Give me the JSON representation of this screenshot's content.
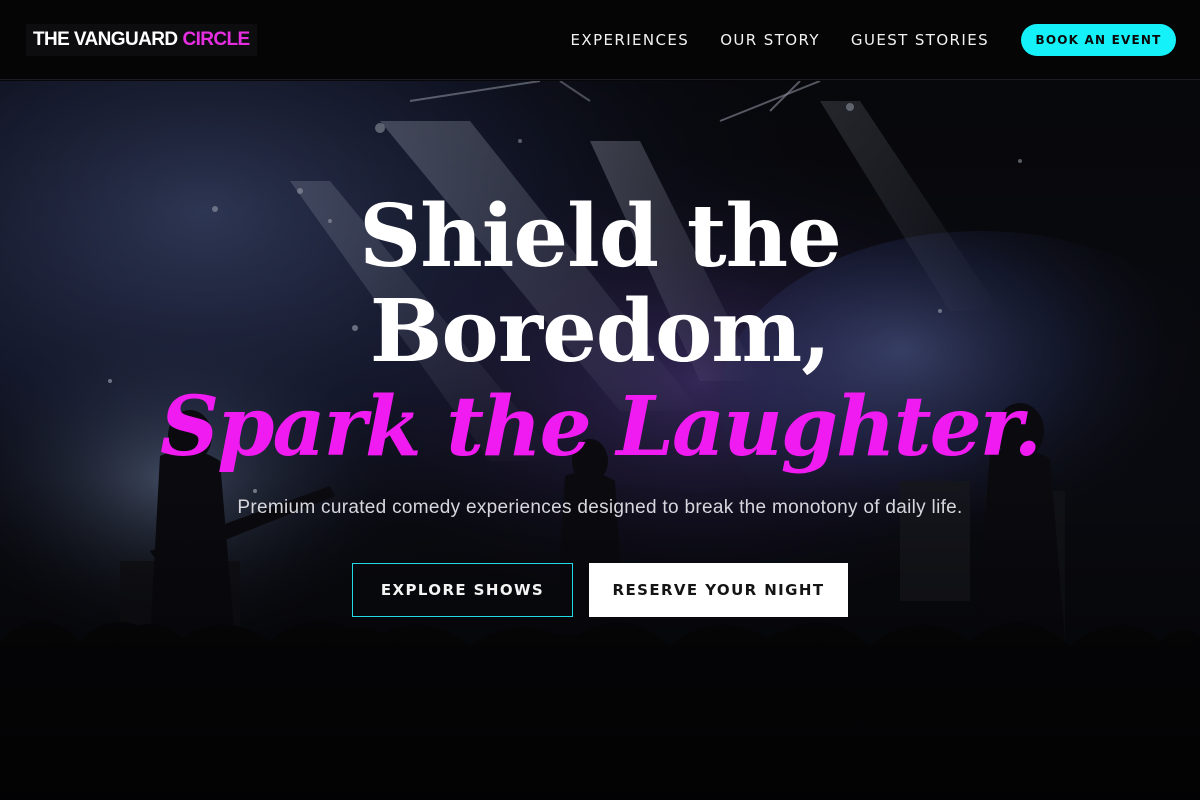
{
  "brand": {
    "primary": "THE VANGUARD",
    "accent": "CIRCLE"
  },
  "nav": {
    "links": [
      "EXPERIENCES",
      "OUR STORY",
      "GUEST STORIES"
    ],
    "cta_label": "BOOK AN EVENT"
  },
  "hero": {
    "title_line1": "Shield the",
    "title_line2": "Boredom,",
    "title_line3": "Spark the Laughter.",
    "subtitle": "Premium curated comedy experiences designed to break the monotony of daily life.",
    "primary_button": "EXPLORE SHOWS",
    "secondary_button": "RESERVE YOUR NIGHT",
    "background": "concert-stage-photo"
  },
  "colors": {
    "accent_magenta": "#f01bf0",
    "accent_cyan": "#14f1f8",
    "background": "#050506"
  }
}
